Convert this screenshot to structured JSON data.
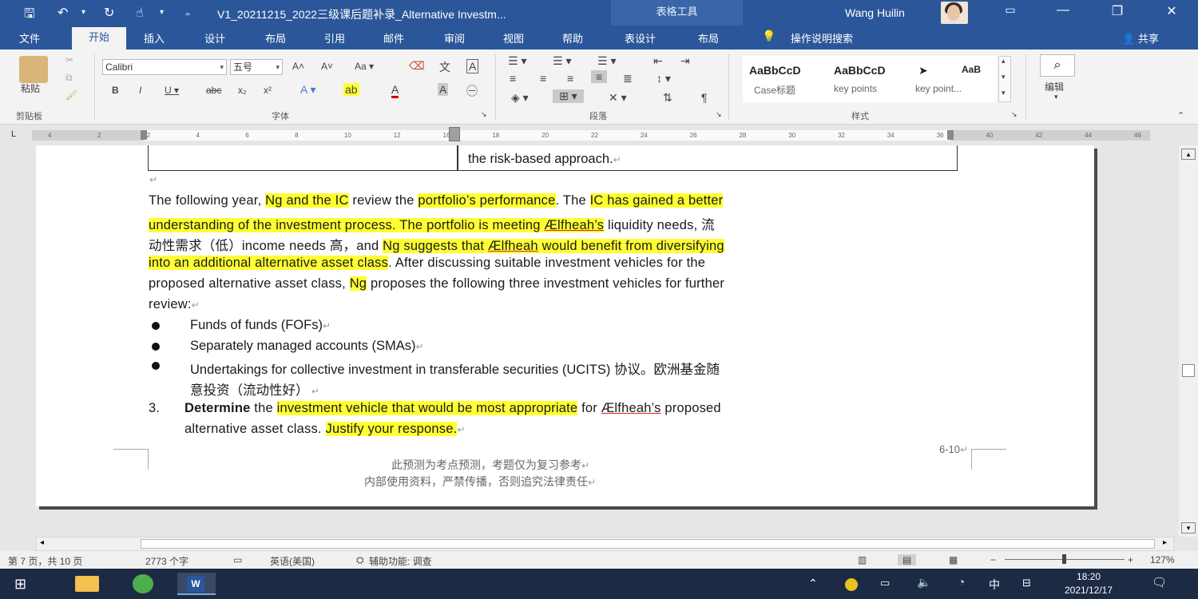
{
  "titlebar": {
    "doc_title": "V1_20211215_2022三级课后题补录_Alternative Investm...",
    "context_tab": "表格工具",
    "user_name": "Wang Huilin"
  },
  "tabs": {
    "file": "文件",
    "home": "开始",
    "insert": "插入",
    "design": "设计",
    "layout": "布局",
    "references": "引用",
    "mailings": "邮件",
    "review": "审阅",
    "view": "视图",
    "help": "帮助",
    "table_design": "表设计",
    "table_layout": "布局",
    "tell_me": "操作说明搜索",
    "share": "共享"
  },
  "ribbon": {
    "paste_label": "粘贴",
    "clipboard_label": "剪贴板",
    "font_name": "Calibri",
    "font_size": "五号",
    "font_group_label": "字体",
    "paragraph_group_label": "段落",
    "styles_group_label": "样式",
    "edit_label": "编辑",
    "styles": [
      {
        "sample": "AaBbCcD",
        "name": "Case标题"
      },
      {
        "sample": "AaBbCcD",
        "name": "key points"
      },
      {
        "sample": "➤",
        "name": "key point..."
      },
      {
        "sample": "AaB",
        "name": ""
      }
    ]
  },
  "ruler_ticks": [
    "4",
    "2",
    "2",
    "4",
    "6",
    "8",
    "10",
    "12",
    "16",
    "18",
    "20",
    "22",
    "24",
    "26",
    "28",
    "30",
    "32",
    "34",
    "36",
    "40",
    "42",
    "44",
    "46"
  ],
  "document": {
    "table_cell_text": "the risk-based approach.",
    "para1": {
      "s1": "The following year, ",
      "h1": "Ng and the IC",
      "s2": " review the ",
      "h2": "portfolio’s performance",
      "s3": ". The ",
      "h3": "IC has gained a better",
      "h4": "understanding of the investment process",
      "s4": ". ",
      "h5": "The portfolio is meeting ",
      "u1": "Ælfheah’s",
      "s5": " liquidity needs, 流",
      "s6": "动性需求（低）income needs 高，and ",
      "h6": "Ng suggests that ",
      "u2": "Ælfheah",
      "h7": " would benefit from diversifying",
      "h8": "into an additional alternative asset class",
      "s7": ". After discussing suitable investment vehicles for the",
      "s8": "proposed alternative asset class, ",
      "h9": "Ng",
      "s9": " proposes the following three investment vehicles for further",
      "s10": "review:"
    },
    "bullets": [
      "Funds of funds (FOFs)",
      "Separately managed accounts (SMAs)",
      "Undertakings for collective investment in transferable securities (UCITS) 协议。欧洲基金随",
      "意投资（流动性好）"
    ],
    "q3": {
      "num": "3.",
      "bold": "Determine",
      "s1": " the ",
      "h1": "investment vehicle that would be most appropriate",
      "s2": " for ",
      "u1": "Ælfheah’s",
      "s3": " proposed",
      "s4": "alternative asset class. ",
      "h2": "Justify your response."
    },
    "page_ref": "6-10",
    "footer1": "此预测为考点预测，考题仅为复习参考",
    "footer2": "内部使用资料，严禁传播，否则追究法律责任"
  },
  "statusbar": {
    "page": "第 7 页，共 10 页",
    "words": "2773 个字",
    "language": "英语(美国)",
    "accessibility": "辅助功能: 调查",
    "zoom": "127%"
  },
  "taskbar": {
    "time": "18:20",
    "date": "2021/12/17",
    "ime": "中"
  }
}
